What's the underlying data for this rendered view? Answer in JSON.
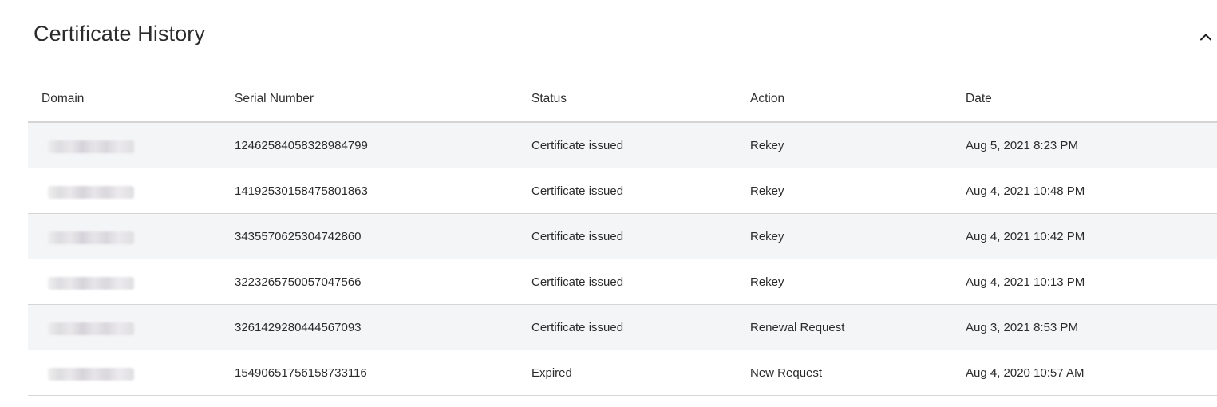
{
  "panel": {
    "title": "Certificate History",
    "collapse_icon": "chevron-up-icon"
  },
  "table": {
    "columns": {
      "domain": "Domain",
      "serial": "Serial Number",
      "status": "Status",
      "action": "Action",
      "date": "Date"
    },
    "rows": [
      {
        "domain": "",
        "serial": "12462584058328984799",
        "status": "Certificate issued",
        "action": "Rekey",
        "date": "Aug 5, 2021 8:23 PM"
      },
      {
        "domain": "",
        "serial": "14192530158475801863",
        "status": "Certificate issued",
        "action": "Rekey",
        "date": "Aug 4, 2021 10:48 PM"
      },
      {
        "domain": "",
        "serial": "3435570625304742860",
        "status": "Certificate issued",
        "action": "Rekey",
        "date": "Aug 4, 2021 10:42 PM"
      },
      {
        "domain": "",
        "serial": "3223265750057047566",
        "status": "Certificate issued",
        "action": "Rekey",
        "date": "Aug 4, 2021 10:13 PM"
      },
      {
        "domain": "",
        "serial": "3261429280444567093",
        "status": "Certificate issued",
        "action": "Renewal Request",
        "date": "Aug 3, 2021 8:53 PM"
      },
      {
        "domain": "",
        "serial": "15490651756158733116",
        "status": "Expired",
        "action": "New Request",
        "date": "Aug 4, 2020 10:57 AM"
      }
    ]
  },
  "colors": {
    "row_shaded": "#f4f5f7",
    "row_plain": "#ffffff",
    "divider": "#d6d6d6",
    "text": "#2b2b2b"
  }
}
